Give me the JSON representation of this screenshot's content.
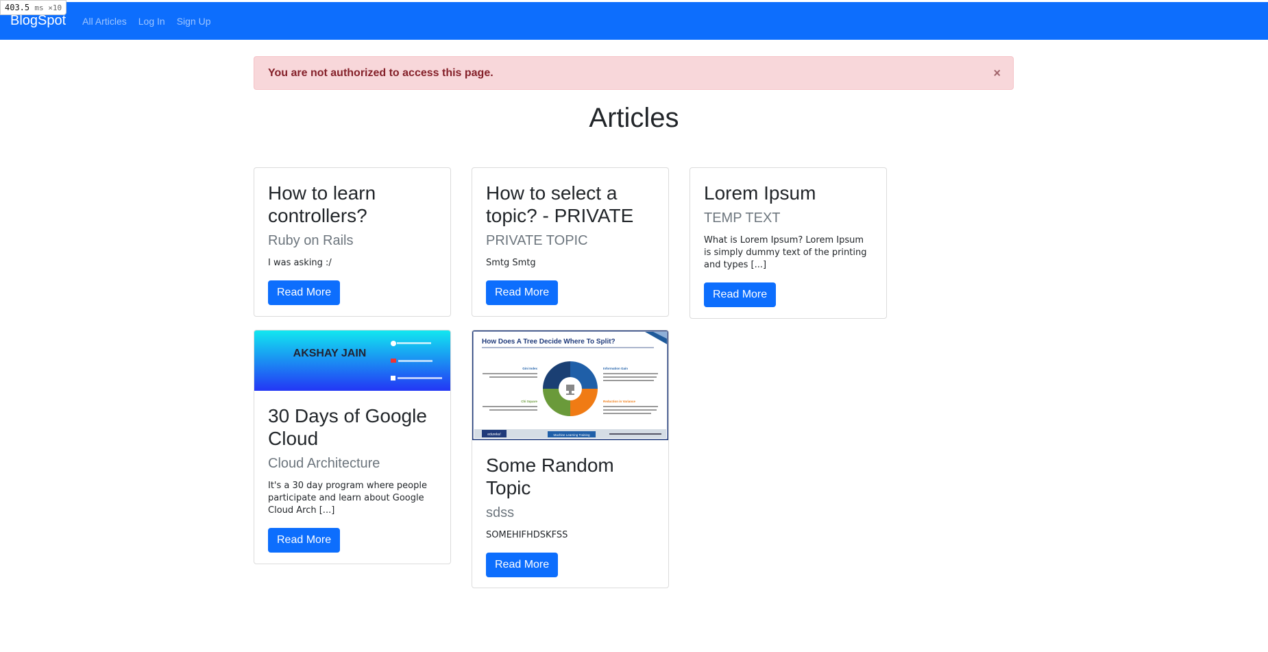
{
  "perf": {
    "value": "403.5",
    "unit": "ms ×10"
  },
  "navbar": {
    "brand": "BlogSpot",
    "links": [
      "All Articles",
      "Log In",
      "Sign Up"
    ]
  },
  "alert": {
    "message": "You are not authorized to access this page.",
    "close": "×"
  },
  "page_title": "Articles",
  "articles": [
    {
      "title": "How to learn controllers?",
      "subtitle": "Ruby on Rails",
      "text": "I was asking :/",
      "button": "Read More"
    },
    {
      "title": "How to select a topic? - PRIVATE",
      "subtitle": "PRIVATE TOPIC",
      "text": "Smtg Smtg",
      "button": "Read More"
    },
    {
      "title": "Lorem Ipsum",
      "subtitle": "TEMP TEXT",
      "text": "What is Lorem Ipsum? Lorem Ipsum is simply dummy text of the printing and types [...]",
      "button": "Read More"
    },
    {
      "title": "30 Days of Google Cloud",
      "subtitle": "Cloud Architecture",
      "text": "It's a 30 day program where people participate and learn about Google Cloud Arch [...]",
      "button": "Read More",
      "image": {
        "banner_name": "AKSHAY JAIN"
      }
    },
    {
      "title": "Some Random Topic",
      "subtitle": "sdss",
      "text": "SOMEHIFHDSKFSS",
      "button": "Read More",
      "image": {
        "heading": "How Does A Tree Decide Where To Split?",
        "labels": [
          "Gini Index",
          "Information Gain",
          "Chi Square",
          "Reduction in Variance"
        ],
        "footer_brand": "edureka!",
        "footer_course": "Machine Learning Training"
      }
    }
  ],
  "colors": {
    "primary": "#0d6efd",
    "alert_bg": "#f8d7da",
    "alert_text": "#842029"
  }
}
